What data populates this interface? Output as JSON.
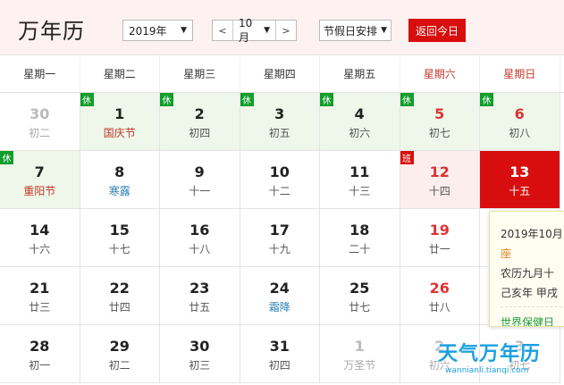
{
  "header": {
    "title": "万年历",
    "year_value": "2019年",
    "month_prev": "<",
    "month_value": "10月",
    "month_next": ">",
    "holiday_value": "节假日安排",
    "today_label": "返回今日"
  },
  "weekdays": [
    "星期一",
    "星期二",
    "星期三",
    "星期四",
    "星期五",
    "星期六",
    "星期日"
  ],
  "days": [
    {
      "num": "30",
      "lunar": "初二",
      "other": true
    },
    {
      "num": "1",
      "lunar": "国庆节",
      "state": "rest",
      "badge": "休",
      "festival": true
    },
    {
      "num": "2",
      "lunar": "初四",
      "state": "rest",
      "badge": "休"
    },
    {
      "num": "3",
      "lunar": "初五",
      "state": "rest",
      "badge": "休"
    },
    {
      "num": "4",
      "lunar": "初六",
      "state": "rest",
      "badge": "休"
    },
    {
      "num": "5",
      "lunar": "初七",
      "state": "rest",
      "badge": "休",
      "weekend": true
    },
    {
      "num": "6",
      "lunar": "初八",
      "state": "rest",
      "badge": "休",
      "weekend": true
    },
    {
      "num": "7",
      "lunar": "重阳节",
      "state": "rest",
      "badge": "休",
      "festival": true
    },
    {
      "num": "8",
      "lunar": "寒露",
      "term": true
    },
    {
      "num": "9",
      "lunar": "十一"
    },
    {
      "num": "10",
      "lunar": "十二"
    },
    {
      "num": "11",
      "lunar": "十三"
    },
    {
      "num": "12",
      "lunar": "十四",
      "state": "work",
      "badge": "班",
      "weekend": true
    },
    {
      "num": "13",
      "lunar": "十五",
      "state": "today",
      "weekend": true
    },
    {
      "num": "14",
      "lunar": "十六"
    },
    {
      "num": "15",
      "lunar": "十七"
    },
    {
      "num": "16",
      "lunar": "十八"
    },
    {
      "num": "17",
      "lunar": "十九"
    },
    {
      "num": "18",
      "lunar": "二十"
    },
    {
      "num": "19",
      "lunar": "廿一",
      "weekend": true
    },
    {
      "num": "",
      "lunar": ""
    },
    {
      "num": "21",
      "lunar": "廿三"
    },
    {
      "num": "22",
      "lunar": "廿四"
    },
    {
      "num": "23",
      "lunar": "廿五"
    },
    {
      "num": "24",
      "lunar": "霜降",
      "term": true
    },
    {
      "num": "25",
      "lunar": "廿七"
    },
    {
      "num": "26",
      "lunar": "廿八",
      "weekend": true
    },
    {
      "num": "",
      "lunar": ""
    },
    {
      "num": "28",
      "lunar": "初一"
    },
    {
      "num": "29",
      "lunar": "初二"
    },
    {
      "num": "30",
      "lunar": "初三"
    },
    {
      "num": "31",
      "lunar": "初四"
    },
    {
      "num": "1",
      "lunar": "万圣节",
      "other": true
    },
    {
      "num": "2",
      "lunar": "初六",
      "other": true
    },
    {
      "num": "3",
      "lunar": "初七",
      "other": true
    }
  ],
  "popup": {
    "date_line": "2019年10月",
    "zodiac_line": "座",
    "lunar_line": "农历九月十",
    "ganzhi_line": "己亥年 甲戌",
    "event_line": "世界保健日"
  },
  "watermark": {
    "main": "天气万年历",
    "sub": "wannianli.tianqi.com"
  },
  "colors": {
    "accent": "#d80e0e",
    "rest_badge": "#119d2a",
    "rest_bg": "#eef7e9",
    "work_bg": "#fdeeee",
    "header_bg": "#fdf1f1",
    "watermark": "#1aa0e0"
  }
}
